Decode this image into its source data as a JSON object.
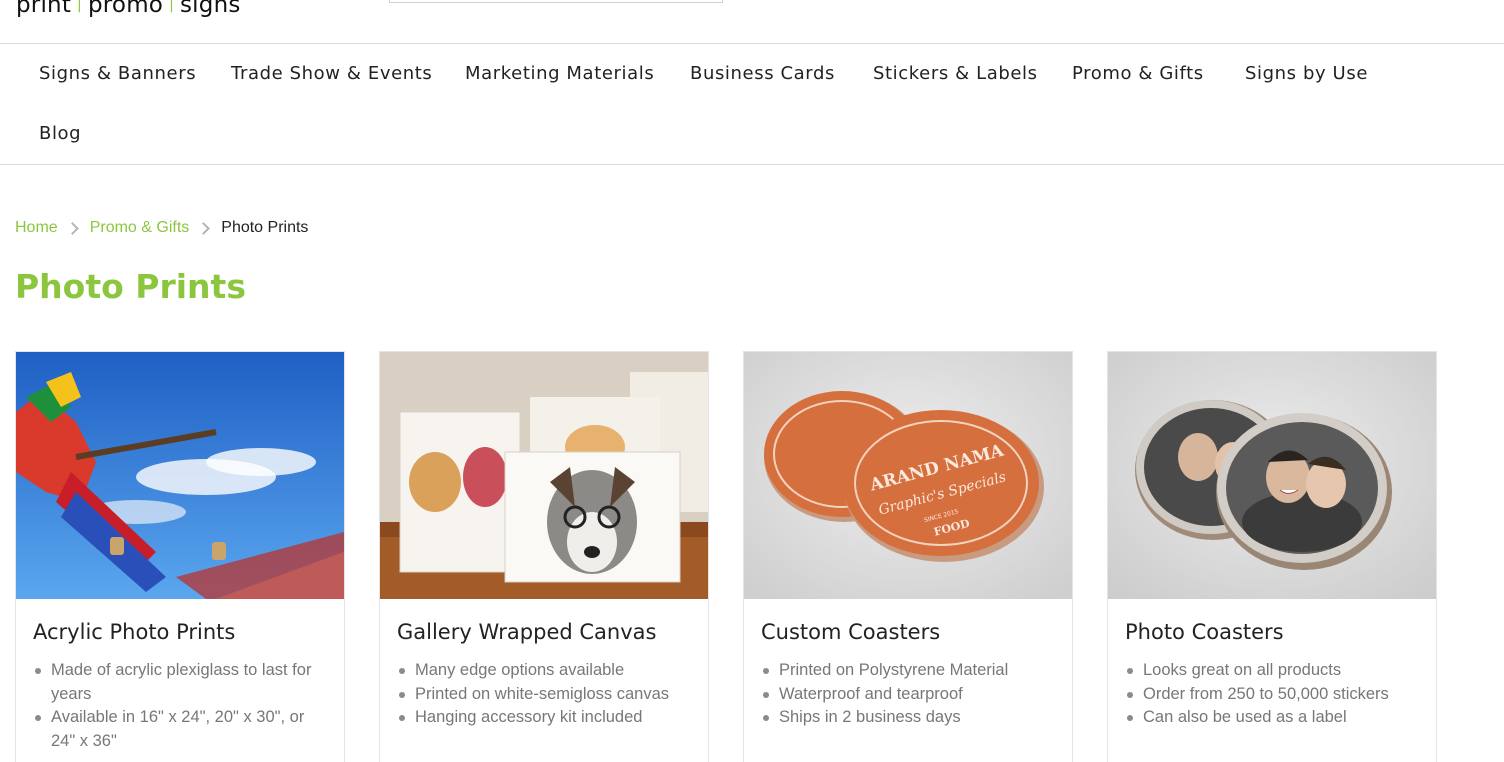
{
  "header": {
    "logo": {
      "part1": "print",
      "part2": "promo",
      "part3": "signs",
      "separator": "|"
    }
  },
  "nav": {
    "items": [
      {
        "label": "Signs & Banners"
      },
      {
        "label": "Trade Show & Events"
      },
      {
        "label": "Marketing Materials"
      },
      {
        "label": "Business Cards"
      },
      {
        "label": "Stickers & Labels"
      },
      {
        "label": "Promo & Gifts"
      },
      {
        "label": "Signs by Use"
      },
      {
        "label": "Blog"
      }
    ]
  },
  "breadcrumb": {
    "home": "Home",
    "parent": "Promo & Gifts",
    "current": "Photo Prints",
    "separator_icon": "chevron-right-icon"
  },
  "page": {
    "title": "Photo Prints"
  },
  "products": [
    {
      "title": "Acrylic Photo Prints",
      "image": "acrylic-print-photo",
      "bullets": [
        "Made of acrylic plexiglass to last for years",
        "Available in 16\" x 24\", 20\" x 30\", or 24\" x 36\""
      ]
    },
    {
      "title": "Gallery Wrapped Canvas",
      "image": "canvas-prints-photo",
      "bullets": [
        "Many edge options available",
        "Printed on white-semigloss canvas",
        "Hanging accessory kit included"
      ]
    },
    {
      "title": "Custom Coasters",
      "image": "orange-coasters-photo",
      "bullets": [
        "Printed on Polystyrene Material",
        "Waterproof and tearproof",
        "Ships in 2 business days"
      ],
      "image_text": {
        "brand": "ARAND NAMA",
        "tagline": "Graphic's Specials",
        "since": "SINCE 2015",
        "food": "FOOD"
      }
    },
    {
      "title": "Photo Coasters",
      "image": "photo-coasters-photo",
      "bullets": [
        "Looks great on all products",
        "Order from 250 to 50,000 stickers",
        "Can also be used as a label"
      ]
    }
  ],
  "colors": {
    "accent": "#8cc63f",
    "text": "#222222",
    "muted": "#777777",
    "border": "#d9d9d9"
  }
}
